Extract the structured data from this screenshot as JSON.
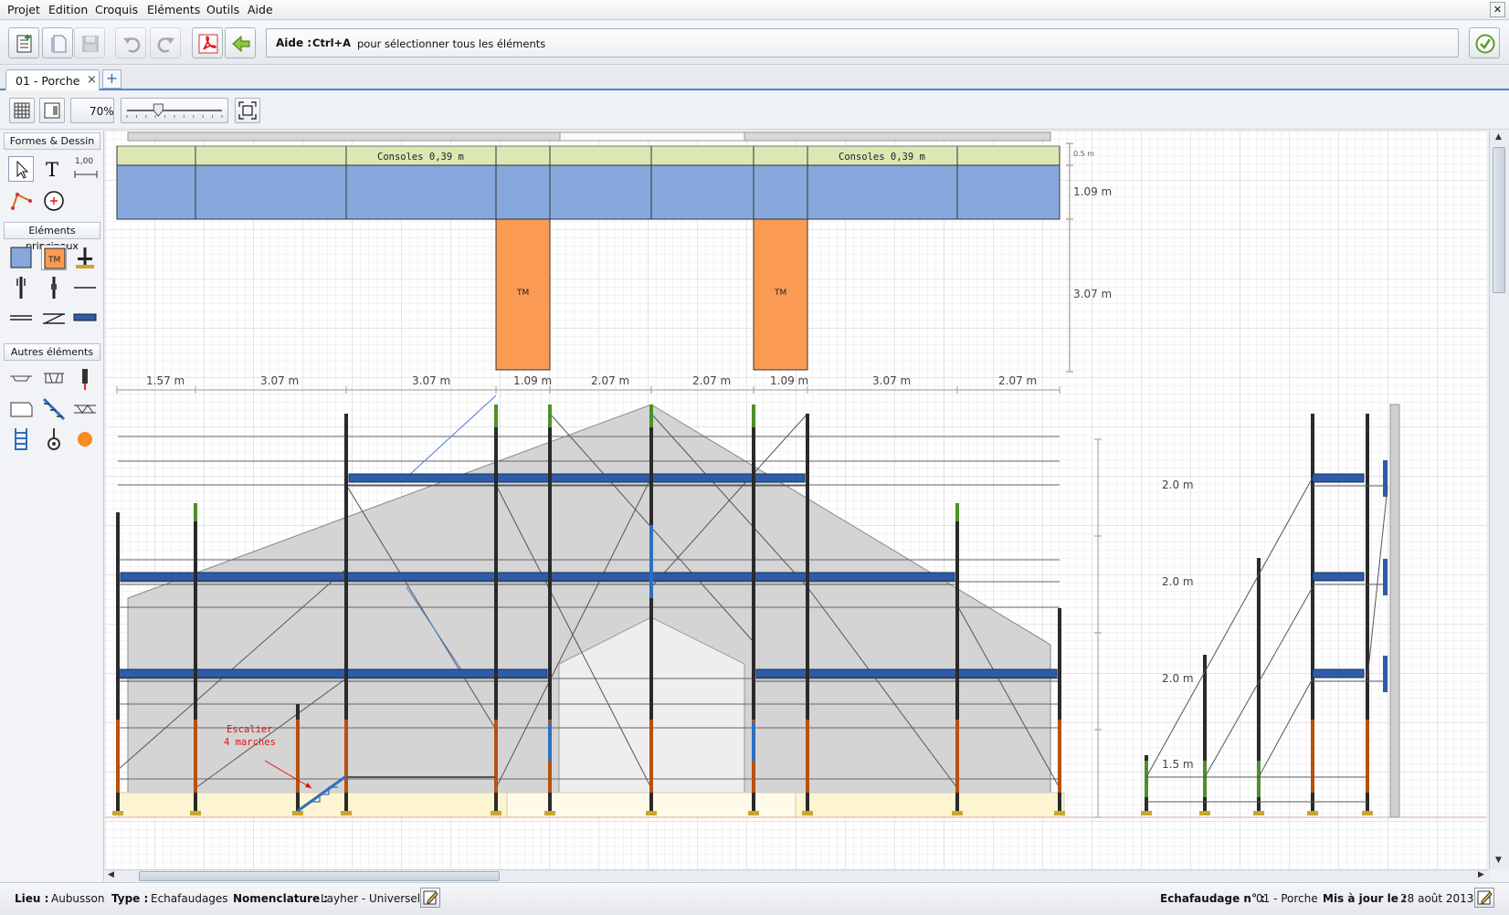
{
  "menubar": {
    "items": [
      "Projet",
      "Edition",
      "Croquis",
      "Eléments",
      "Outils",
      "Aide"
    ],
    "close": "✕"
  },
  "toolbar": {
    "buttons": [
      "new-project",
      "open",
      "save",
      "undo",
      "redo",
      "export-pdf",
      "back"
    ],
    "help_label": "Aide :",
    "help_key": "Ctrl+A",
    "help_text": "pour sélectionner tous les éléments"
  },
  "tabs": {
    "items": [
      {
        "label": "01 - Porche",
        "close": "×"
      }
    ],
    "add": "+"
  },
  "view": {
    "zoom": "70%",
    "zoom_slider_fraction": 0.33
  },
  "palette": {
    "sections": [
      "Formes & Dessin",
      "Eléments principaux",
      "Autres éléments"
    ],
    "ruler_label": "1,00",
    "tm_label": "TM"
  },
  "plan": {
    "consoles_label": "Consoles 0,39 m",
    "tm_label": "TM",
    "right_dims": [
      "0.5 m",
      "1.09 m",
      "3.07 m"
    ],
    "bay_widths": [
      "1.57 m",
      "3.07 m",
      "3.07 m",
      "1.09 m",
      "2.07 m",
      "2.07 m",
      "1.09 m",
      "3.07 m",
      "2.07 m"
    ]
  },
  "elevation": {
    "annotation_line1": "Escalier",
    "annotation_line2": "4 marches",
    "level_heights": [
      "2.0 m",
      "2.0 m",
      "2.0 m",
      "1.5 m"
    ]
  },
  "status": {
    "lieu_label": "Lieu :",
    "lieu": "Aubusson",
    "type_label": "Type :",
    "type": "Echafaudages",
    "nomenclature_label": "Nomenclature :",
    "nomenclature": "Layher - Universel",
    "echafaudage_label": "Echafaudage n° :",
    "echafaudage": "01 - Porche",
    "maj_label": "Mis à jour le :",
    "maj": "28 août 2013"
  },
  "colors": {
    "deck_blue": "#2e5ca8",
    "plan_blue": "#86a8dc",
    "console_green": "#dbe8b4",
    "tm_orange": "#fb9a52",
    "building_gray": "#d4d4d4",
    "annotation_red": "#dd1111"
  }
}
